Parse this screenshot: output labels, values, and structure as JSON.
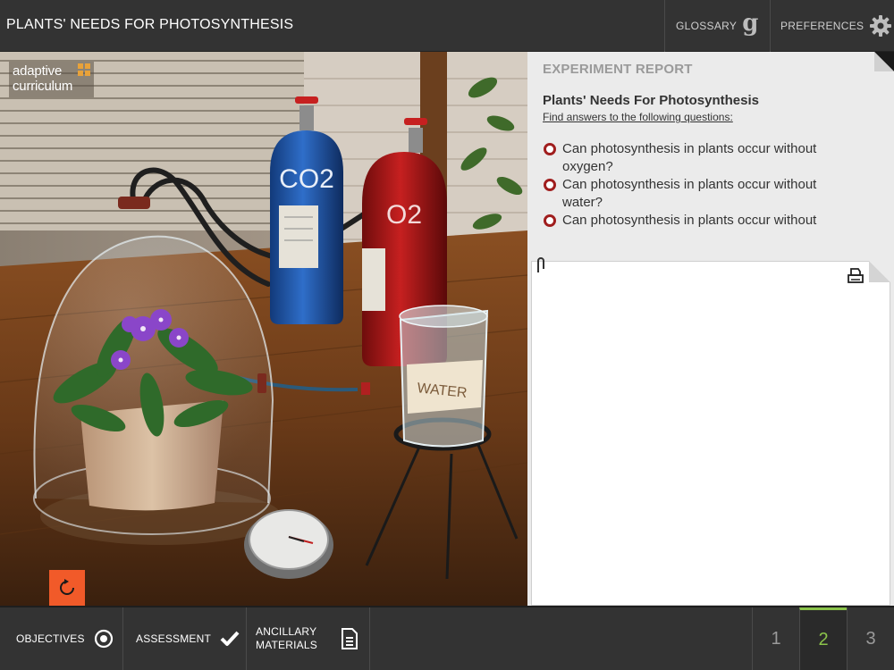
{
  "header": {
    "title": "PLANTS' NEEDS FOR PHOTOSYNTHESIS",
    "glossary_label": "GLOSSARY",
    "glossary_glyph": "g",
    "preferences_label": "PREFERENCES"
  },
  "scene": {
    "logo_line1": "adaptive",
    "logo_line2": "curriculum",
    "co2_label": "CO2",
    "o2_label": "O2",
    "water_label": "WATER"
  },
  "report": {
    "heading": "EXPERIMENT REPORT",
    "title": "Plants' Needs For Photosynthesis",
    "subtitle": "Find answers to the following questions:",
    "questions": [
      "Can photosynthesis in plants occur without oxygen?",
      "Can photosynthesis in plants occur without water?",
      "Can photosynthesis in plants occur without"
    ]
  },
  "footer": {
    "objectives_label": "OBJECTIVES",
    "assessment_label": "ASSESSMENT",
    "ancillary_line1": "ANCILLARY",
    "ancillary_line2": "MATERIALS",
    "pages": [
      "1",
      "2",
      "3"
    ],
    "active_page": "2"
  },
  "colors": {
    "accent_green": "#8bc34a",
    "reset_orange": "#f15a29",
    "radio_red": "#a01e1e",
    "bar_dark": "#333333"
  },
  "icons": {
    "glossary": "glossary-g-icon",
    "preferences": "gear-icon",
    "reset": "reset-icon",
    "objectives": "target-icon",
    "assessment": "checkmark-icon",
    "ancillary": "document-icon",
    "print": "print-icon",
    "clip": "paperclip-icon"
  }
}
